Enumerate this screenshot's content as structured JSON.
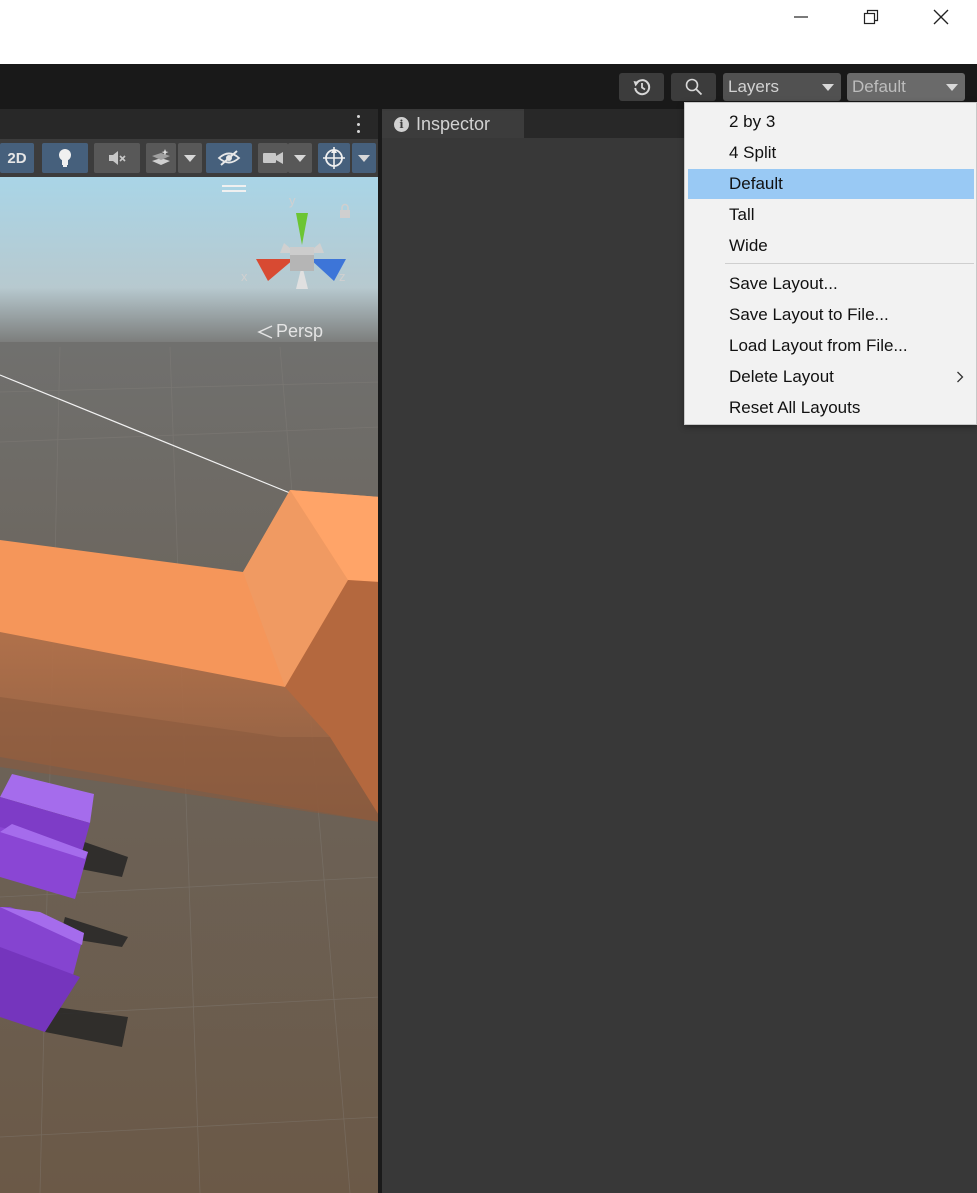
{
  "window": {
    "minimize_icon": "minimize-icon",
    "restore_icon": "restore-icon",
    "close_icon": "close-icon"
  },
  "toolbar": {
    "history_icon": "history-icon",
    "search_icon": "search-icon",
    "layers_dropdown": {
      "label": "Layers"
    },
    "layout_dropdown": {
      "label": "Default"
    }
  },
  "scene_view": {
    "toolbar_buttons": {
      "toggle_2d": "2D",
      "lighting": "lightbulb-icon",
      "audio": "audio-mute-icon",
      "effects": "effects-icon",
      "visibility": "hidden-eye-icon",
      "camera": "camera-icon",
      "gizmos": "gizmo-icon"
    },
    "gizmo": {
      "y_label": "y",
      "x_label": "x",
      "z_label": "z"
    },
    "projection_label": "Persp",
    "colors": {
      "sky": "#a9d5e7",
      "ground": "#6f5c4a",
      "wall": "#f5965a",
      "blocks": "#8a3fd4"
    }
  },
  "inspector": {
    "tab_label": "Inspector"
  },
  "layout_menu": {
    "items": [
      {
        "label": "2 by 3"
      },
      {
        "label": "4 Split"
      },
      {
        "label": "Default",
        "selected": true
      },
      {
        "label": "Tall"
      },
      {
        "label": "Wide"
      },
      {
        "label": "Save Layout..."
      },
      {
        "label": "Save Layout to File..."
      },
      {
        "label": "Load Layout from File..."
      },
      {
        "label": "Delete Layout",
        "has_submenu": true
      },
      {
        "label": "Reset All Layouts"
      }
    ],
    "colors": {
      "selected": "#99c9f4",
      "background": "#f2f2f2"
    }
  }
}
